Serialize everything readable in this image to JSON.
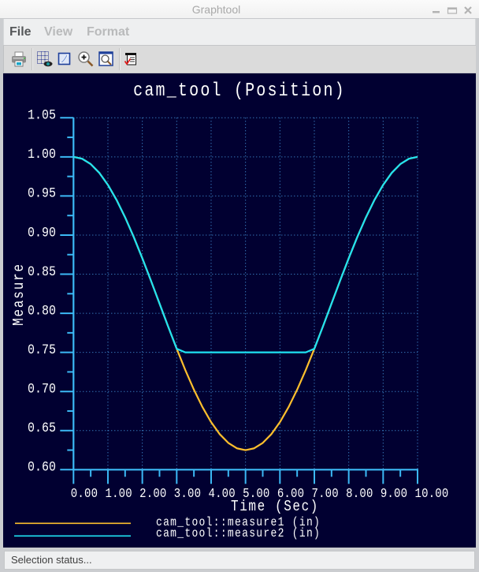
{
  "window": {
    "title": "Graphtool",
    "controls": [
      {
        "name": "minimize",
        "icon": "minimize-icon"
      },
      {
        "name": "maximize",
        "icon": "maximize-icon"
      },
      {
        "name": "close",
        "icon": "close-icon"
      }
    ]
  },
  "menu": {
    "items": [
      {
        "label": "File",
        "enabled": true
      },
      {
        "label": "View",
        "enabled": false
      },
      {
        "label": "Format",
        "enabled": false
      }
    ]
  },
  "toolbar": {
    "buttons": [
      {
        "icon": "print-icon"
      },
      {
        "icon": "grid-visibility-icon"
      },
      {
        "icon": "format-page-icon"
      },
      {
        "icon": "zoom-in-icon"
      },
      {
        "icon": "zoom-window-icon"
      },
      {
        "icon": "legend-check-icon"
      }
    ]
  },
  "status_bar": {
    "text": "Selection status..."
  },
  "colors": {
    "chart_background": "#010031",
    "axis": "#3cb9f5",
    "grid": "#4ba3ec",
    "text": "#ffffff"
  },
  "chart_data": {
    "type": "line",
    "title": "cam_tool (Position)",
    "xlabel": "Time (Sec)",
    "ylabel": "Measure",
    "xlim": [
      0,
      10
    ],
    "ylim": [
      0.6,
      1.05
    ],
    "xticks": {
      "values": [
        0,
        1,
        2,
        3,
        4,
        5,
        6,
        7,
        8,
        9,
        10
      ],
      "labels": [
        "0.00",
        "1.00",
        "2.00",
        "3.00",
        "4.00",
        "5.00",
        "6.00",
        "7.00",
        "8.00",
        "9.00",
        "10.00"
      ]
    },
    "yticks": {
      "values": [
        0.6,
        0.65,
        0.7,
        0.75,
        0.8,
        0.85,
        0.9,
        0.95,
        1.0,
        1.05
      ],
      "labels": [
        "0.60",
        "0.65",
        "0.70",
        "0.75",
        "0.80",
        "0.85",
        "0.90",
        "0.95",
        "1.00",
        "1.05"
      ]
    },
    "grid": true,
    "legend_position": "bottom-left",
    "x": [
      0,
      0.25,
      0.5,
      0.75,
      1,
      1.25,
      1.5,
      1.75,
      2,
      2.25,
      2.5,
      2.75,
      3,
      3.25,
      3.5,
      3.75,
      4,
      4.25,
      4.5,
      4.75,
      5,
      5.25,
      5.5,
      5.75,
      6,
      6.25,
      6.5,
      6.75,
      7,
      7.25,
      7.5,
      7.75,
      8,
      8.25,
      8.5,
      8.75,
      9,
      9.25,
      9.5,
      9.75,
      10
    ],
    "series": [
      {
        "name": "cam_tool::measure1 (in)",
        "color": "#fdbf2d",
        "values": [
          1.0,
          0.9977,
          0.9908,
          0.9796,
          0.9642,
          0.9451,
          0.9227,
          0.8976,
          0.8704,
          0.8418,
          0.8125,
          0.7832,
          0.7546,
          0.7274,
          0.7023,
          0.6799,
          0.6608,
          0.6454,
          0.6342,
          0.6273,
          0.625,
          0.6273,
          0.6342,
          0.6454,
          0.6608,
          0.6799,
          0.7023,
          0.7274,
          0.7546,
          0.7832,
          0.8125,
          0.8418,
          0.8704,
          0.8976,
          0.9227,
          0.9451,
          0.9642,
          0.9796,
          0.9908,
          0.9977,
          1.0
        ]
      },
      {
        "name": "cam_tool::measure2 (in)",
        "color": "#1fe3f2",
        "values": [
          1.0,
          0.9977,
          0.9908,
          0.9796,
          0.9642,
          0.9451,
          0.9227,
          0.8976,
          0.8704,
          0.8418,
          0.8125,
          0.7832,
          0.7546,
          0.75,
          0.75,
          0.75,
          0.75,
          0.75,
          0.75,
          0.75,
          0.75,
          0.75,
          0.75,
          0.75,
          0.75,
          0.75,
          0.75,
          0.75,
          0.7546,
          0.7832,
          0.8125,
          0.8418,
          0.8704,
          0.8976,
          0.9227,
          0.9451,
          0.9642,
          0.9796,
          0.9908,
          0.9977,
          1.0
        ]
      }
    ]
  }
}
